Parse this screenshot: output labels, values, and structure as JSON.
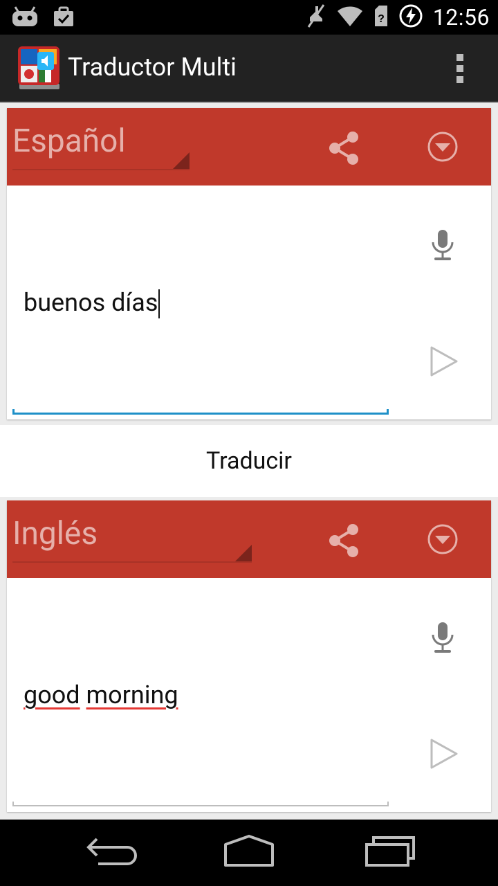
{
  "status_bar": {
    "time": "12:56",
    "left_icons": [
      "android-debug-icon",
      "task-done-icon"
    ],
    "right_icons": [
      "silent-icon",
      "wifi-icon",
      "sim-icon",
      "battery-charging-icon"
    ]
  },
  "action_bar": {
    "title": "Traductor Multi",
    "app_icon": "flags-book-icon",
    "overflow_icon": "overflow-menu-icon"
  },
  "source_panel": {
    "language": "Español",
    "text": "buenos días",
    "share_icon": "share-icon",
    "dropdown_icon": "dropdown-circle-icon",
    "mic_icon": "microphone-icon",
    "play_icon": "play-icon"
  },
  "translate_button": {
    "label": "Traducir"
  },
  "target_panel": {
    "language": "Inglés",
    "words": [
      "good",
      "morning"
    ],
    "share_icon": "share-icon",
    "dropdown_icon": "dropdown-circle-icon",
    "mic_icon": "microphone-icon",
    "play_icon": "play-icon"
  },
  "nav_bar": {
    "buttons": [
      "back-icon",
      "home-icon",
      "recents-icon"
    ]
  },
  "colors": {
    "header_red": "#c0392b",
    "language_text": "#e6b0aa",
    "accent_blue": "#1e90c8",
    "spellcheck_red": "#e53935"
  }
}
